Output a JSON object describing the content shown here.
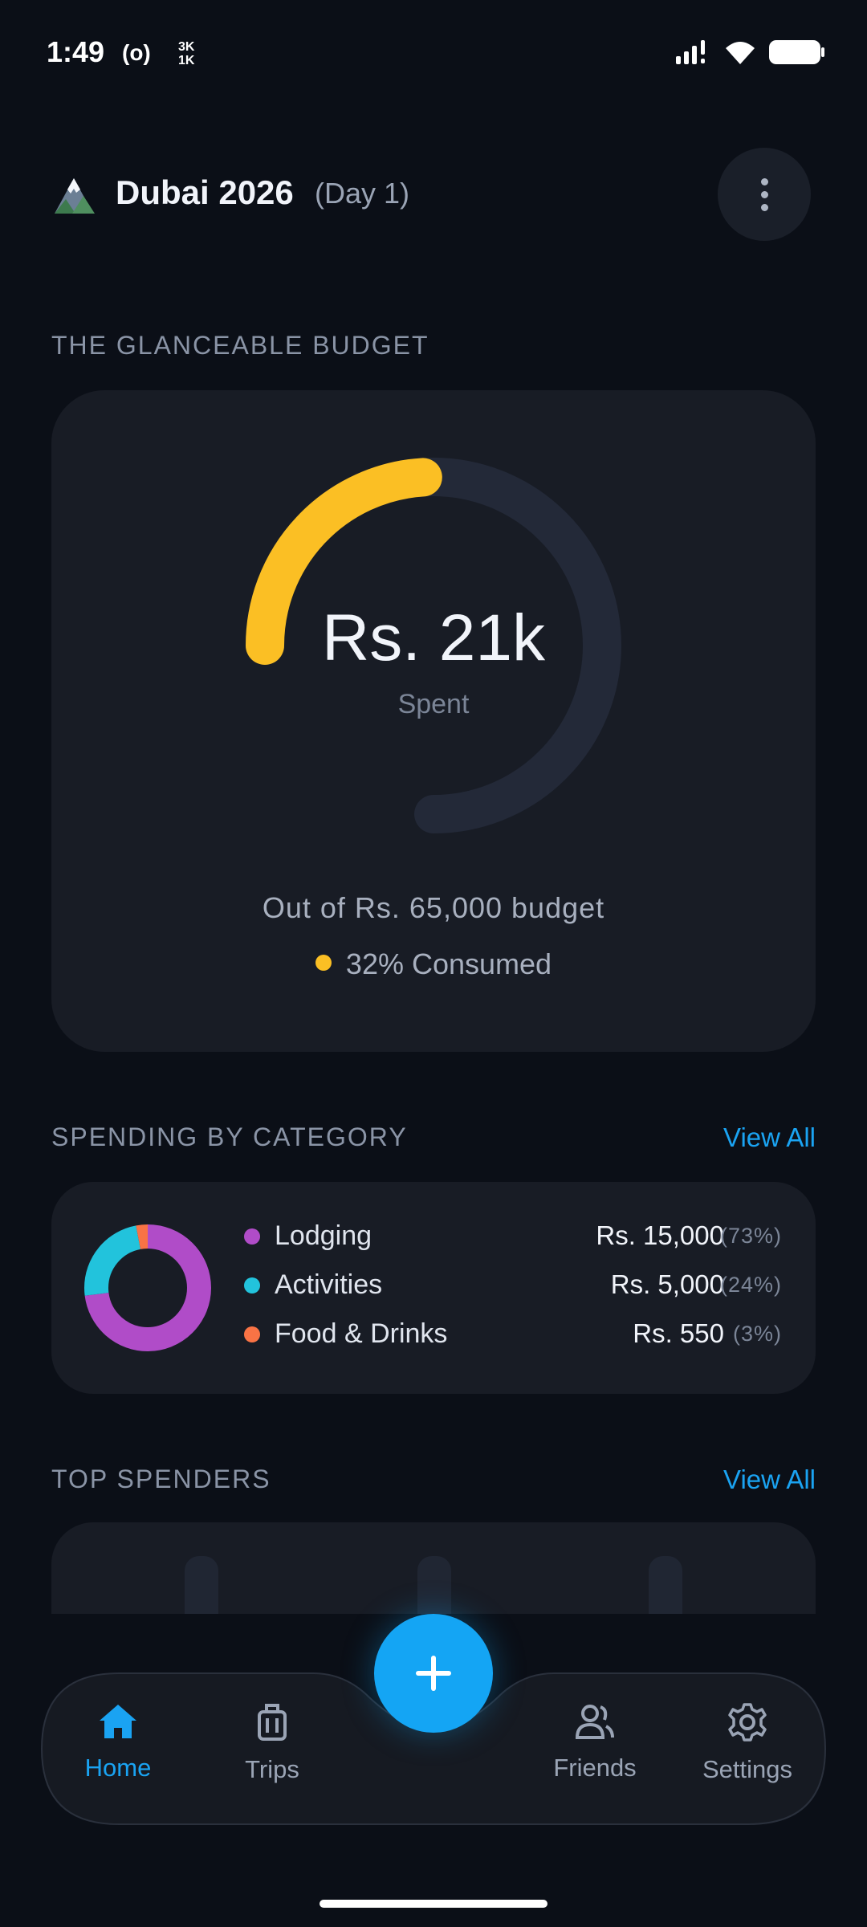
{
  "status_bar": {
    "time": "1:49",
    "radio_glyph": "(o)",
    "speed_up": "3K",
    "speed_down": "1K",
    "icons": [
      "signal-icon",
      "wifi-icon",
      "battery-icon"
    ]
  },
  "header": {
    "icon": "mountain-icon",
    "title": "Dubai 2026",
    "day": "(Day 1)",
    "menu_icon": "more-vertical-icon"
  },
  "budget": {
    "section_label": "THE GLANCEABLE BUDGET",
    "spent": "Rs. 21k",
    "spent_label": "Spent",
    "out_of": "Out of Rs. 65,000 budget",
    "consumed": "32% Consumed",
    "consumed_fraction": 0.32,
    "accent_color": "#fbbf24",
    "track_color": "#232938"
  },
  "categories": {
    "section_label": "SPENDING BY CATEGORY",
    "view_all": "View All",
    "items": [
      {
        "name": "Lodging",
        "amount": "Rs. 15,000",
        "pct": "(73%)",
        "share": 0.73,
        "color": "#b04cc8"
      },
      {
        "name": "Activities",
        "amount": "Rs. 5,000",
        "pct": "(24%)",
        "share": 0.24,
        "color": "#22c3dc"
      },
      {
        "name": "Food & Drinks",
        "amount": "Rs. 550",
        "pct": "(3%)",
        "share": 0.03,
        "color": "#f97345"
      }
    ]
  },
  "top_spenders": {
    "section_label": "TOP SPENDERS",
    "view_all": "View All",
    "bar_color": "#34d399",
    "bars": 3
  },
  "nav": {
    "items": [
      {
        "label": "Home",
        "icon": "home-icon",
        "active": true
      },
      {
        "label": "Trips",
        "icon": "luggage-icon",
        "active": false
      },
      {
        "label": "Friends",
        "icon": "users-icon",
        "active": false
      },
      {
        "label": "Settings",
        "icon": "gear-icon",
        "active": false
      }
    ],
    "fab_icon": "plus-icon",
    "active_color": "#1aa3f2"
  }
}
